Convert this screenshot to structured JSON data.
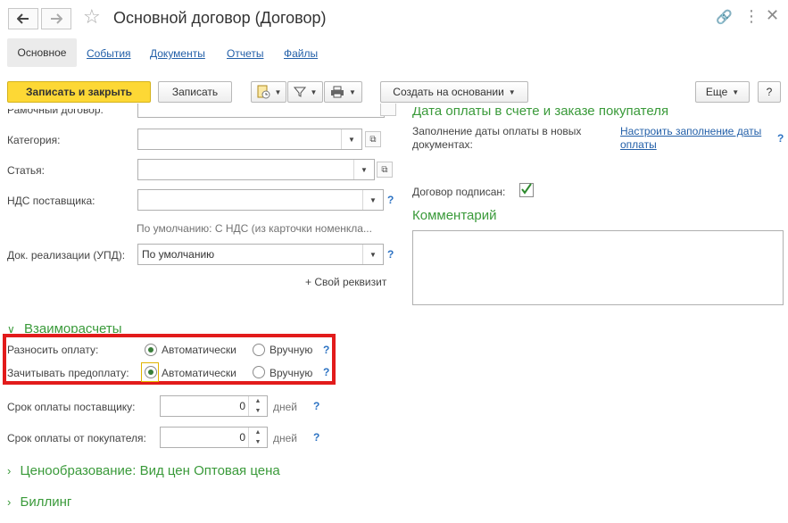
{
  "window": {
    "title": "Основной договор (Договор)"
  },
  "tabs": [
    {
      "label": "Основное"
    },
    {
      "label": "События"
    },
    {
      "label": "Документы"
    },
    {
      "label": "Отчеты"
    },
    {
      "label": "Файлы"
    }
  ],
  "toolbar": {
    "save_close": "Записать и закрыть",
    "save": "Записать",
    "create_based": "Создать на основании",
    "more": "Еще",
    "help": "?"
  },
  "left": {
    "cut_label": "Рамочный договор:",
    "category_label": "Категория:",
    "article_label": "Статья:",
    "vat_label": "НДС поставщика:",
    "vat_hint": "По умолчанию: С НДС (из карточки номенкла...",
    "doc_label": "Док. реализации (УПД):",
    "doc_value": "По умолчанию",
    "own_prop": "+ Свой реквизит"
  },
  "right": {
    "cut_section": "Дата оплаты в счете и заказе покупателя",
    "fill_label": "Заполнение даты оплаты в новых документах:",
    "fill_link": "Настроить заполнение даты оплаты",
    "signed_label": "Договор подписан:",
    "comment_title": "Комментарий",
    "comment_value": ""
  },
  "settlements": {
    "section": "Взаиморасчеты",
    "pay_label": "Разносить оплату:",
    "prepay_label": "Зачитывать предоплату:",
    "auto": "Автоматически",
    "manual": "Вручную",
    "supplier_term_label": "Срок оплаты поставщику:",
    "supplier_term_value": "0",
    "buyer_term_label": "Срок оплаты от покупателя:",
    "buyer_term_value": "0",
    "days": "дней"
  },
  "pricing": {
    "section": "Ценообразование: Вид цен Оптовая цена"
  },
  "billing": {
    "section": "Биллинг"
  },
  "colors": {
    "accent": "#fdd835",
    "section_green": "#3a9a3a",
    "link_blue": "#225fa8",
    "highlight_red": "#e21b1b"
  }
}
